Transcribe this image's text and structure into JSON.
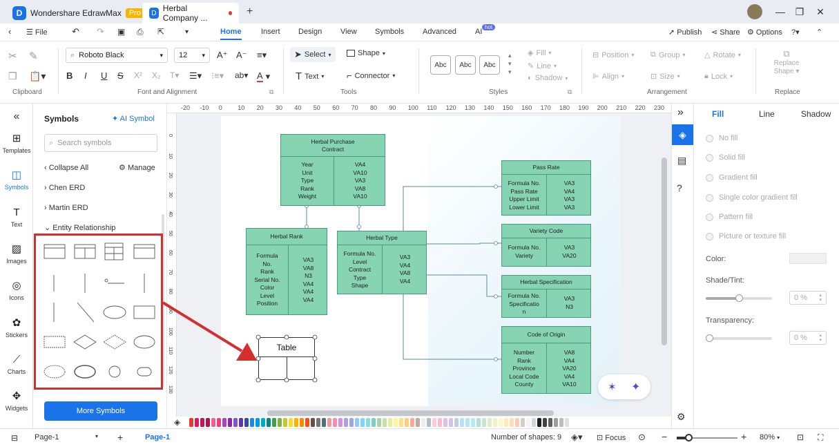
{
  "titlebar": {
    "app_name": "Wondershare EdrawMax",
    "badge": "Pro",
    "doc_tab": "Herbal Company ...",
    "new_tab": "+"
  },
  "menu": {
    "file": "File",
    "tabs": [
      "Home",
      "Insert",
      "Design",
      "View",
      "Symbols",
      "Advanced",
      "AI"
    ],
    "ai_badge": "hot",
    "active": "Home",
    "publish": "Publish",
    "share": "Share",
    "options": "Options"
  },
  "ribbon": {
    "font_name": "Roboto Black",
    "font_size": "12",
    "select": "Select",
    "shape": "Shape",
    "text": "Text",
    "connector": "Connector",
    "style_sample": "Abc",
    "fill": "Fill",
    "line": "Line",
    "shadow": "Shadow",
    "position": "Position",
    "group": "Group",
    "rotate": "Rotate",
    "align": "Align",
    "size": "Size",
    "lock": "Lock",
    "replace_shape": "Replace Shape",
    "groups": {
      "clipboard": "Clipboard",
      "font": "Font and Alignment",
      "tools": "Tools",
      "styles": "Styles",
      "arrangement": "Arrangement",
      "replace": "Replace"
    }
  },
  "leftrail": [
    "Templates",
    "Symbols",
    "Text",
    "Images",
    "Icons",
    "Stickers",
    "Charts",
    "Widgets"
  ],
  "symbols_panel": {
    "title": "Symbols",
    "ai_symbol": "AI Symbol",
    "search_placeholder": "Search symbols",
    "collapse_all": "Collapse All",
    "manage": "Manage",
    "libraries": [
      "Chen ERD",
      "Martin ERD",
      "Entity Relationship"
    ],
    "more_symbols": "More Symbols"
  },
  "ruler": {
    "top": [
      "-20",
      "-10",
      "0",
      "10",
      "20",
      "30",
      "40",
      "50",
      "60",
      "70",
      "80",
      "90",
      "100",
      "110",
      "120",
      "130",
      "140",
      "150",
      "160",
      "170",
      "180",
      "190",
      "200",
      "210",
      "220",
      "230"
    ],
    "left": [
      "0",
      "10",
      "20",
      "30",
      "40",
      "50",
      "60",
      "70",
      "80",
      "90",
      "100",
      "110",
      "120",
      "130"
    ]
  },
  "diagram": {
    "tables": [
      {
        "title": "Herbal Purchase\nContract",
        "fields": "Year\nUnit\nType\nRank\nWeight",
        "types": "VA4\nVA10\nVA3\nVA8\nVA10"
      },
      {
        "title": "Herbal Rank",
        "fields": "Formula\nNo.\nRank\nSerial No.\nColor\nLevel\nPosition",
        "types": "VA3\nVA8\nN3\nVA4\nVA4\nVA4"
      },
      {
        "title": "Herbal Type",
        "fields": "Formula No.\nLevel\nContract\nType\nShape",
        "types": "VA3\nVA4\nVA8\nVA4"
      },
      {
        "title": "Pass Rate",
        "fields": "Formula No.\nPass Rate\nUpper Limit\nLower Limit",
        "types": "VA3\nVA4\nVA3\nVA3"
      },
      {
        "title": "Variety Code",
        "fields": "Formula No.\nVariety",
        "types": "VA3\nVA20"
      },
      {
        "title": "Herbal Specification",
        "fields": "Formula No.\nSpecificatio\nn",
        "types": "VA3\nN3"
      },
      {
        "title": "Code of Origin",
        "fields": "Number\nRank\nProvince\nLocal Code\nCounty",
        "types": "VA8\nVA4\nVA20\nVA4\nVA10"
      }
    ],
    "new_table_label": "Table"
  },
  "props": {
    "tabs": [
      "Fill",
      "Line",
      "Shadow"
    ],
    "options": [
      "No fill",
      "Solid fill",
      "Gradient fill",
      "Single color gradient fill",
      "Pattern fill",
      "Picture or texture fill"
    ],
    "color_label": "Color:",
    "shade_label": "Shade/Tint:",
    "shade_value": "0 %",
    "transparency_label": "Transparency:",
    "transparency_value": "0 %"
  },
  "status": {
    "page_select": "Page-1",
    "page_tab": "Page-1",
    "shape_count": "Number of shapes: 9",
    "focus": "Focus",
    "zoom": "80%"
  },
  "palette_colors": [
    "#e53935",
    "#d81b60",
    "#c2185b",
    "#ad1457",
    "#f06292",
    "#ec407a",
    "#ab47bc",
    "#8e24aa",
    "#7e57c2",
    "#5e35b1",
    "#3949ab",
    "#1e88e5",
    "#039be5",
    "#00acc1",
    "#00897b",
    "#43a047",
    "#7cb342",
    "#c0ca33",
    "#fdd835",
    "#ffb300",
    "#fb8c00",
    "#f4511e",
    "#6d4c41",
    "#757575",
    "#546e7a",
    "#ef9a9a",
    "#f48fb1",
    "#ce93d8",
    "#b39ddb",
    "#9fa8da",
    "#90caf9",
    "#81d4fa",
    "#80deea",
    "#80cbc4",
    "#a5d6a7",
    "#c5e1a5",
    "#e6ee9c",
    "#fff59d",
    "#ffe082",
    "#ffcc80",
    "#ffab91",
    "#bcaaa4",
    "#eeeeee",
    "#b0bec5",
    "#ffcdd2",
    "#f8bbd0",
    "#e1bee7",
    "#d1c4e9",
    "#c5cae9",
    "#bbdefb",
    "#b3e5fc",
    "#b2ebf2",
    "#b2dfdb",
    "#c8e6c9",
    "#dcedc8",
    "#f0f4c3",
    "#fff9c4",
    "#ffecb3",
    "#ffe0b2",
    "#ffccbc",
    "#d7ccc8",
    "#f5f5f5",
    "#cfd8dc",
    "#212121",
    "#424242",
    "#616161",
    "#9e9e9e",
    "#bdbdbd",
    "#e0e0e0",
    "#ffffff"
  ]
}
